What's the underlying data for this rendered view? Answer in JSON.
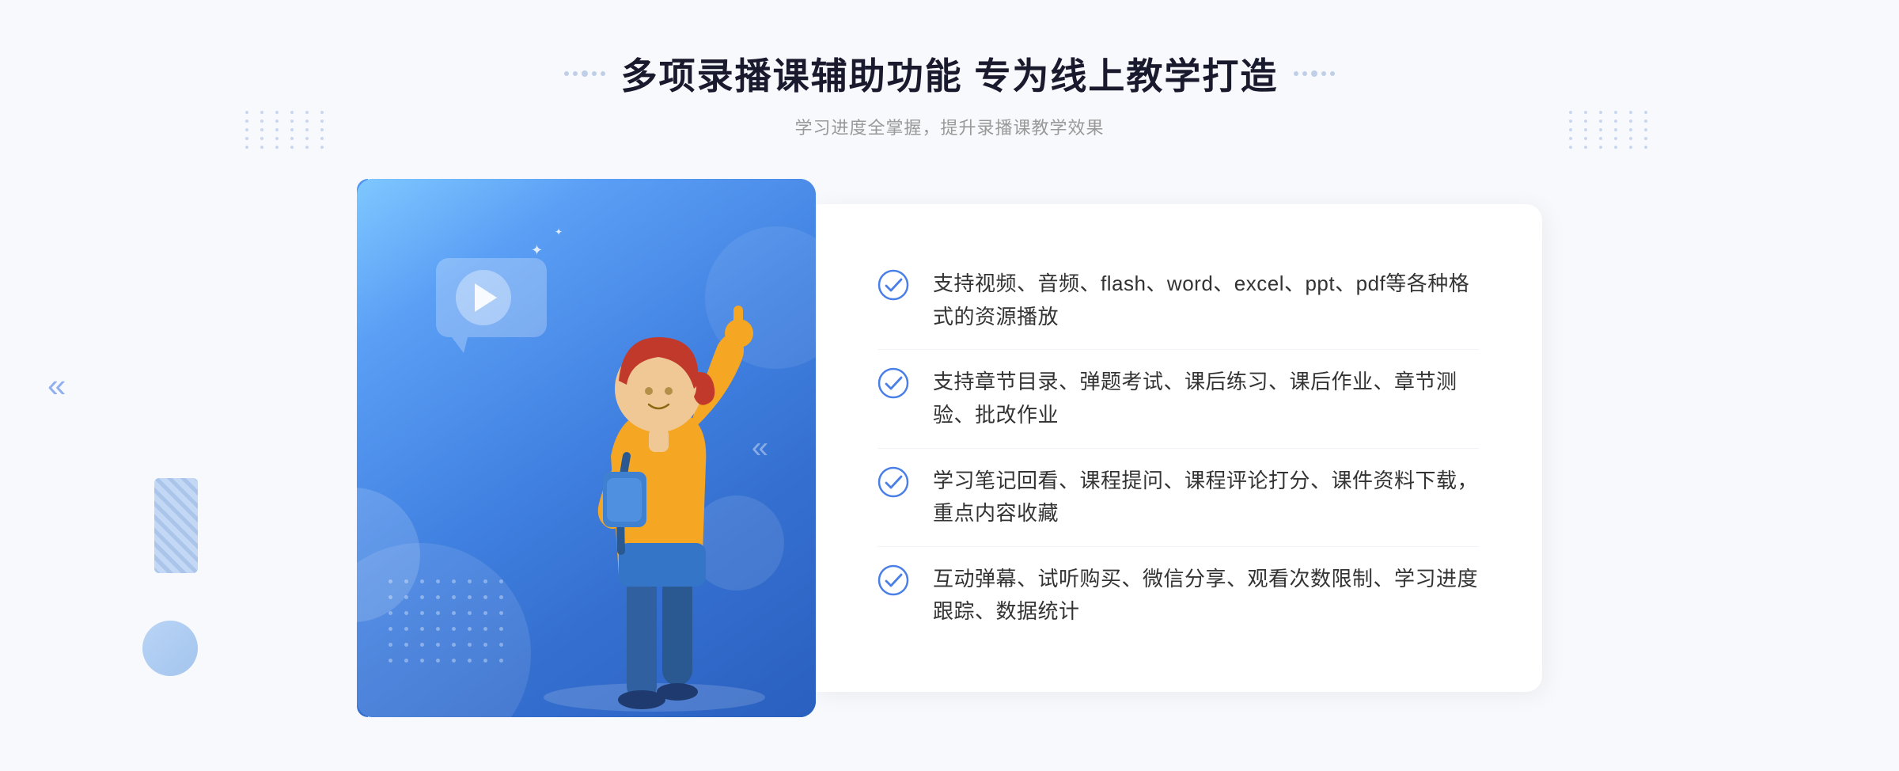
{
  "page": {
    "background_color": "#f8f9fc"
  },
  "header": {
    "title": "多项录播课辅助功能 专为线上教学打造",
    "subtitle": "学习进度全掌握，提升录播课教学效果",
    "decoration_left": "❋ ❋",
    "decoration_right": "❋ ❋"
  },
  "features": [
    {
      "id": 1,
      "text": "支持视频、音频、flash、word、excel、ppt、pdf等各种格式的资源播放"
    },
    {
      "id": 2,
      "text": "支持章节目录、弹题考试、课后练习、课后作业、章节测验、批改作业"
    },
    {
      "id": 3,
      "text": "学习笔记回看、课程提问、课程评论打分、课件资料下载，重点内容收藏"
    },
    {
      "id": 4,
      "text": "互动弹幕、试听购买、微信分享、观看次数限制、学习进度跟踪、数据统计"
    }
  ],
  "icons": {
    "check": "check-circle",
    "play": "play",
    "left_arrow": "«",
    "sparkle": "✦"
  },
  "colors": {
    "primary": "#4a7fe8",
    "primary_light": "#7eb8ff",
    "primary_dark": "#3060c0",
    "text_dark": "#1a1a2e",
    "text_medium": "#333333",
    "text_light": "#999999",
    "white": "#ffffff",
    "bg": "#f8f9fc",
    "check_color": "#4a7fe8"
  }
}
